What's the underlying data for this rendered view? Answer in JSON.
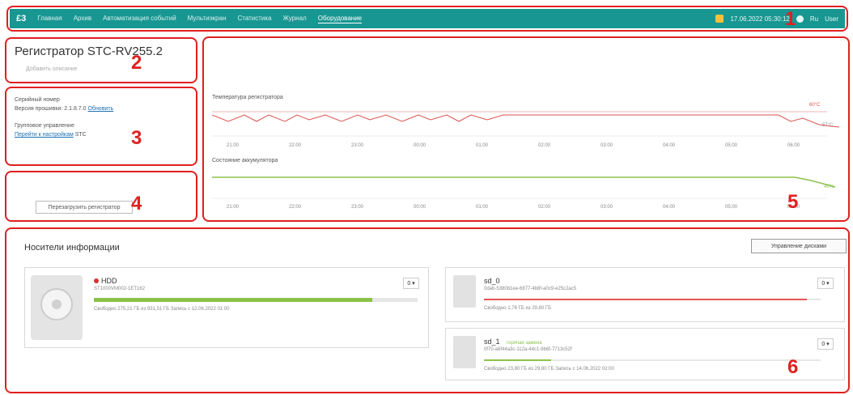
{
  "nav": {
    "logo": "£3",
    "items": [
      "Главная",
      "Архив",
      "Автоматизация событий",
      "Мультиэкран",
      "Статистика",
      "Журнал",
      "Оборудование"
    ],
    "active_index": 6,
    "datetime": "17.06.2022 05:30:12",
    "lang": "Ru",
    "user": "User"
  },
  "device": {
    "title": "Регистратор STC-RV255.2",
    "subtitle": "Добавить описание"
  },
  "info": {
    "line1": "Серийный номер",
    "line2_label": "Версия прошивки: 2.1.8.7.0",
    "line2_link": "Обновить",
    "line3": "Групповое управление",
    "line4_link": "Перейти к настройкам",
    "line4_tail": "STC"
  },
  "actions": {
    "button": "Перезагрузить регистратор"
  },
  "charts": {
    "top_label": "Температура регистратора",
    "top_value": "60°C",
    "top_end": "57°C",
    "bottom_label": "Состояние аккумулятора",
    "bottom_end": "40%",
    "ticks_top": [
      "21:00",
      "22:00",
      "23:00",
      "00:00",
      "01:00",
      "02:00",
      "03:00",
      "04:00",
      "05:00",
      "06:00"
    ],
    "ticks_bottom": [
      "21:00",
      "22:00",
      "23:00",
      "00:00",
      "01:00",
      "02:00",
      "03:00",
      "04:00",
      "05:00",
      "06:00"
    ]
  },
  "storage": {
    "title": "Носители информации",
    "manage_button": "Управление дисками",
    "hdd": {
      "name": "HDD",
      "serial": "ST1000VM002-1ET162",
      "usage_text": "Свободно 275,21 ГБ из 931,51 ГБ  Запись с 12.06.2022 01:00",
      "fill": 0.86,
      "dropdown": "0 ▾"
    },
    "sd0": {
      "name": "sd_0",
      "serial": "0dab-5380b1ee-6877-4b8f-a0c9-e25c2ac5",
      "usage_text": "Свободно 1,76 ГБ из 29,80 ГБ",
      "fill": 0.96,
      "color": "#e05555",
      "dropdown": "0 ▾"
    },
    "sd1": {
      "name": "sd_1",
      "tag": "горячая замена",
      "serial": "0f70-a6f44a3c-112a-44c1-9b6f-7713c52f",
      "usage_text": "Свободно 23,80 ГБ из 29,80 ГБ  Запись с 14.06.2022 02:00",
      "fill": 0.2,
      "color": "#8bc34a",
      "dropdown": "0 ▾"
    }
  },
  "markers": [
    "1",
    "2",
    "3",
    "4",
    "5",
    "6"
  ]
}
